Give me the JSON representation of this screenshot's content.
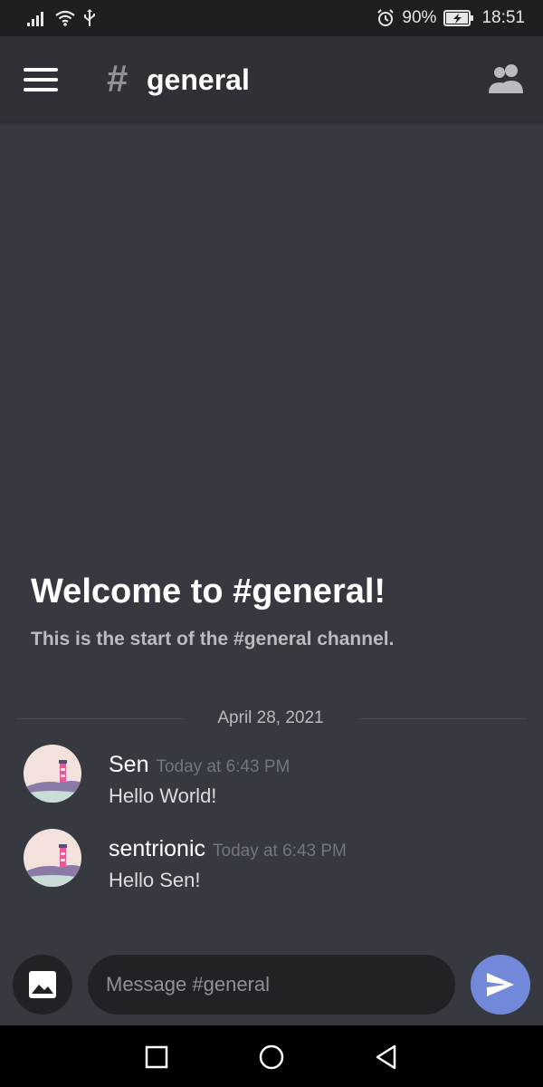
{
  "status_bar": {
    "battery": "90%",
    "time": "18:51"
  },
  "header": {
    "channel_name": "general"
  },
  "welcome": {
    "title": "Welcome to #general!",
    "subtitle": "This is the start of the #general channel."
  },
  "date_divider": "April 28, 2021",
  "messages": [
    {
      "author": "Sen",
      "timestamp": "Today at 6:43 PM",
      "text": "Hello World!"
    },
    {
      "author": "sentrionic",
      "timestamp": "Today at 6:43 PM",
      "text": "Hello Sen!"
    }
  ],
  "composer": {
    "placeholder": "Message #general"
  },
  "colors": {
    "background": "#36393f",
    "header": "#2f3136",
    "input": "#202225",
    "accent": "#7289da"
  },
  "icons": {
    "menu": "hamburger-icon",
    "channel": "hash-icon",
    "members": "members-icon",
    "attach": "image-icon",
    "send": "send-icon"
  }
}
